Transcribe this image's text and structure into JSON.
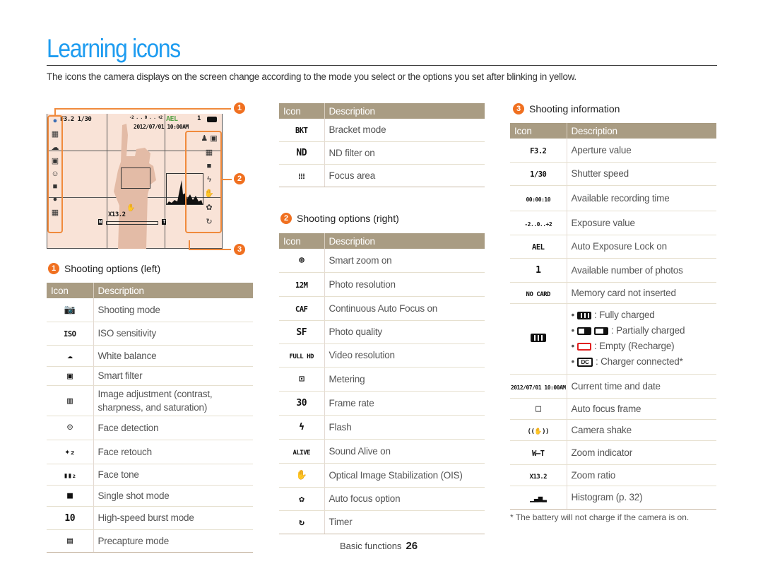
{
  "page": {
    "title": "Learning icons",
    "intro": "The icons the camera displays on the screen change according to the mode you select or the options you set after blinking in yellow.",
    "footer_section": "Basic functions",
    "footer_page": "26",
    "footnote": "* The battery will not charge if the camera is on."
  },
  "colors": {
    "title": "#1e9cf0",
    "badge": "#f07020",
    "table_header": "#a99c83",
    "callout": "#f08a3c"
  },
  "screen": {
    "badges": [
      "1",
      "2",
      "3"
    ],
    "aperture": "F3.2",
    "shutter": "1/30",
    "ev_scale": "-2 . . 0 . . +2",
    "ael": "AEL",
    "photos": "1",
    "datetime": "2012/07/01  10:00AM",
    "zoom_ratio": "X13.2",
    "zoom_w": "W",
    "zoom_t": "T"
  },
  "table_headers": {
    "icon": "Icon",
    "description": "Description"
  },
  "sections": {
    "left": {
      "number": "1",
      "title": "Shooting options (left)",
      "rows": [
        {
          "icon": "shooting-mode-icon",
          "glyph": "📷",
          "desc": "Shooting mode"
        },
        {
          "icon": "iso-icon",
          "glyph": "ISO",
          "desc": "ISO sensitivity"
        },
        {
          "icon": "white-balance-icon",
          "glyph": "☁",
          "desc": "White balance"
        },
        {
          "icon": "smart-filter-icon",
          "glyph": "▣",
          "desc": "Smart filter"
        },
        {
          "icon": "image-adjust-icon",
          "glyph": "▥",
          "desc": "Image adjustment (contrast, sharpness, and saturation)"
        },
        {
          "icon": "face-detection-icon",
          "glyph": "☺",
          "desc": "Face detection"
        },
        {
          "icon": "face-retouch-icon",
          "glyph": "✦₂",
          "desc": "Face retouch"
        },
        {
          "icon": "face-tone-icon",
          "glyph": "▮▮₂",
          "desc": "Face tone"
        },
        {
          "icon": "single-shot-icon",
          "glyph": "■",
          "desc": "Single shot mode"
        },
        {
          "icon": "burst-icon",
          "glyph": "10",
          "desc": "High-speed burst mode"
        },
        {
          "icon": "precapture-icon",
          "glyph": "▤",
          "desc": "Precapture mode"
        }
      ]
    },
    "left_cont": {
      "rows": [
        {
          "icon": "bracket-icon",
          "glyph": "BKT",
          "desc": "Bracket mode"
        },
        {
          "icon": "nd-filter-icon",
          "glyph": "ND",
          "desc": "ND filter on"
        },
        {
          "icon": "focus-area-icon",
          "glyph": "⁞⁞⁞",
          "desc": "Focus area"
        }
      ]
    },
    "right": {
      "number": "2",
      "title": "Shooting options (right)",
      "rows": [
        {
          "icon": "smart-zoom-icon",
          "glyph": "⊕",
          "desc": "Smart zoom on"
        },
        {
          "icon": "photo-resolution-icon",
          "glyph": "12M",
          "desc": "Photo resolution"
        },
        {
          "icon": "caf-icon",
          "glyph": "CAF",
          "desc": "Continuous Auto Focus on"
        },
        {
          "icon": "photo-quality-icon",
          "glyph": "SF",
          "desc": "Photo quality"
        },
        {
          "icon": "video-resolution-icon",
          "glyph": "FULL HD",
          "desc": "Video resolution"
        },
        {
          "icon": "metering-icon",
          "glyph": "⊡",
          "desc": "Metering"
        },
        {
          "icon": "frame-rate-icon",
          "glyph": "30",
          "desc": "Frame rate"
        },
        {
          "icon": "flash-icon",
          "glyph": "ϟ",
          "desc": "Flash"
        },
        {
          "icon": "sound-alive-icon",
          "glyph": "ALIVE",
          "desc": "Sound Alive on"
        },
        {
          "icon": "ois-icon",
          "glyph": "✋",
          "desc": "Optical Image Stabilization (OIS)"
        },
        {
          "icon": "af-option-icon",
          "glyph": "✿",
          "desc": "Auto focus option"
        },
        {
          "icon": "timer-icon",
          "glyph": "↻",
          "desc": "Timer"
        }
      ]
    },
    "info": {
      "number": "3",
      "title": "Shooting information",
      "rows": [
        {
          "icon": "aperture-icon",
          "glyph": "F3.2",
          "desc": "Aperture value"
        },
        {
          "icon": "shutter-icon",
          "glyph": "1/30",
          "desc": "Shutter speed"
        },
        {
          "icon": "rec-time-icon",
          "glyph": "00:00:10",
          "desc": "Available recording time"
        },
        {
          "icon": "exposure-icon",
          "glyph": "-2..0..+2",
          "desc": "Exposure value"
        },
        {
          "icon": "ael-icon",
          "glyph": "AEL",
          "desc": "Auto Exposure Lock on"
        },
        {
          "icon": "photos-count-icon",
          "glyph": "1",
          "desc": "Available number of photos"
        },
        {
          "icon": "no-card-icon",
          "glyph": "NO CARD",
          "desc": "Memory card not inserted"
        },
        {
          "icon": "battery-icon",
          "glyph": "",
          "desc": ""
        },
        {
          "icon": "datetime-icon",
          "glyph": "2012/07/01 10:00AM",
          "desc": "Current time and date"
        },
        {
          "icon": "af-frame-icon",
          "glyph": "□",
          "desc": "Auto focus frame"
        },
        {
          "icon": "camera-shake-icon",
          "glyph": "((✋))",
          "desc": "Camera shake"
        },
        {
          "icon": "zoom-indicator-icon",
          "glyph": "W—T",
          "desc": "Zoom indicator"
        },
        {
          "icon": "zoom-ratio-icon",
          "glyph": "X13.2",
          "desc": "Zoom ratio"
        },
        {
          "icon": "histogram-icon",
          "glyph": "▁▃▅▂",
          "desc": "Histogram (p. 32)"
        }
      ],
      "battery_states": [
        ": Fully charged",
        ": Partially charged",
        ": Empty (Recharge)",
        ": Charger connected*"
      ],
      "battery_dc": "DC"
    }
  }
}
